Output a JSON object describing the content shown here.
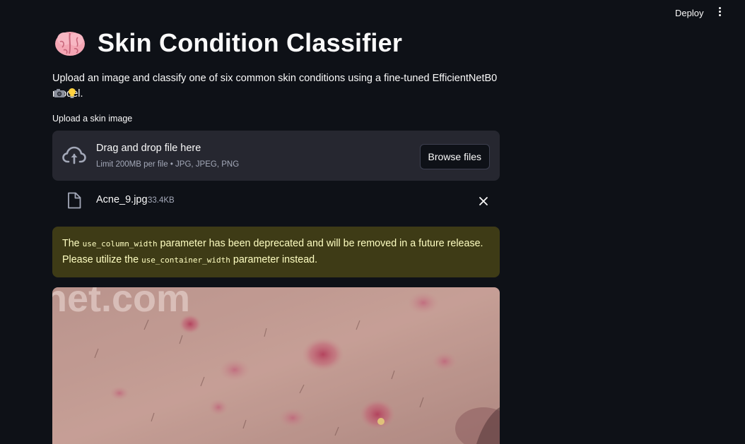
{
  "header": {
    "deploy_label": "Deploy",
    "menu_icon": "vertical-dots-icon"
  },
  "page": {
    "title_icon": "brain-emoji",
    "title": "Skin Condition Classifier",
    "subtitle": "Upload an image and classify one of six common skin conditions using a fine-tuned EfficientNetB0 model.",
    "subtitle_emojis": [
      "camera-emoji",
      "lightbulb-emoji"
    ]
  },
  "uploader": {
    "label": "Upload a skin image",
    "drop_text": "Drag and drop file here",
    "limit_text": "Limit 200MB per file • JPG, JPEG, PNG",
    "browse_label": "Browse files",
    "icon": "cloud-upload-icon"
  },
  "uploaded_file": {
    "name": "Acne_9.jpg",
    "size": "33.4KB",
    "icon": "file-icon",
    "remove_icon": "close-icon"
  },
  "warning": {
    "part1": "The ",
    "code1": "use_column_width",
    "part2": " parameter has been deprecated and will be removed in a future release. Please utilize the ",
    "code2": "use_container_width",
    "part3": " parameter instead."
  },
  "image_preview": {
    "watermark": "net.com"
  },
  "colors": {
    "background": "#0e1117",
    "dropzone": "#262730",
    "warning_bg": "#3e3b16",
    "warning_text": "#ffffc2"
  }
}
